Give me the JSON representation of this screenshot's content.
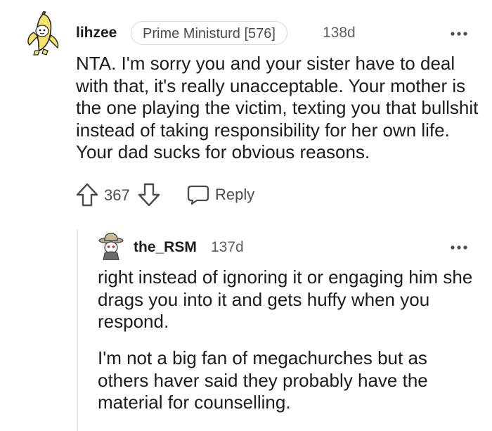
{
  "comment": {
    "username": "lihzee",
    "flair": "Prime Ministurd [576]",
    "timestamp": "138d",
    "body": "NTA. I'm sorry you and your sister have to deal with that, it's really unacceptable. Your mother is the one playing the victim, texting you that bullshit instead of taking responsibility for her own life. Your dad sucks for obvious reasons.",
    "vote_count": "367",
    "reply_label": "Reply",
    "avatar_icon": "banana-avatar-icon",
    "more_icon": "more-options-icon"
  },
  "reply": {
    "username": "the_RSM",
    "timestamp": "137d",
    "paragraphs": [
      "right instead of ignoring it or engaging him she drags you into it and gets huffy when you respond.",
      "I'm not a big fan of megachurches but as others haver said they probably have the material for counselling."
    ],
    "avatar_icon": "cowboy-avatar-icon",
    "more_icon": "more-options-icon"
  },
  "colors": {
    "text": "#1c1c1c",
    "meta": "#5c5f62",
    "icon": "#4a4d50",
    "flair_border": "#d7d9dc",
    "thread_line": "#e8e9eb"
  }
}
